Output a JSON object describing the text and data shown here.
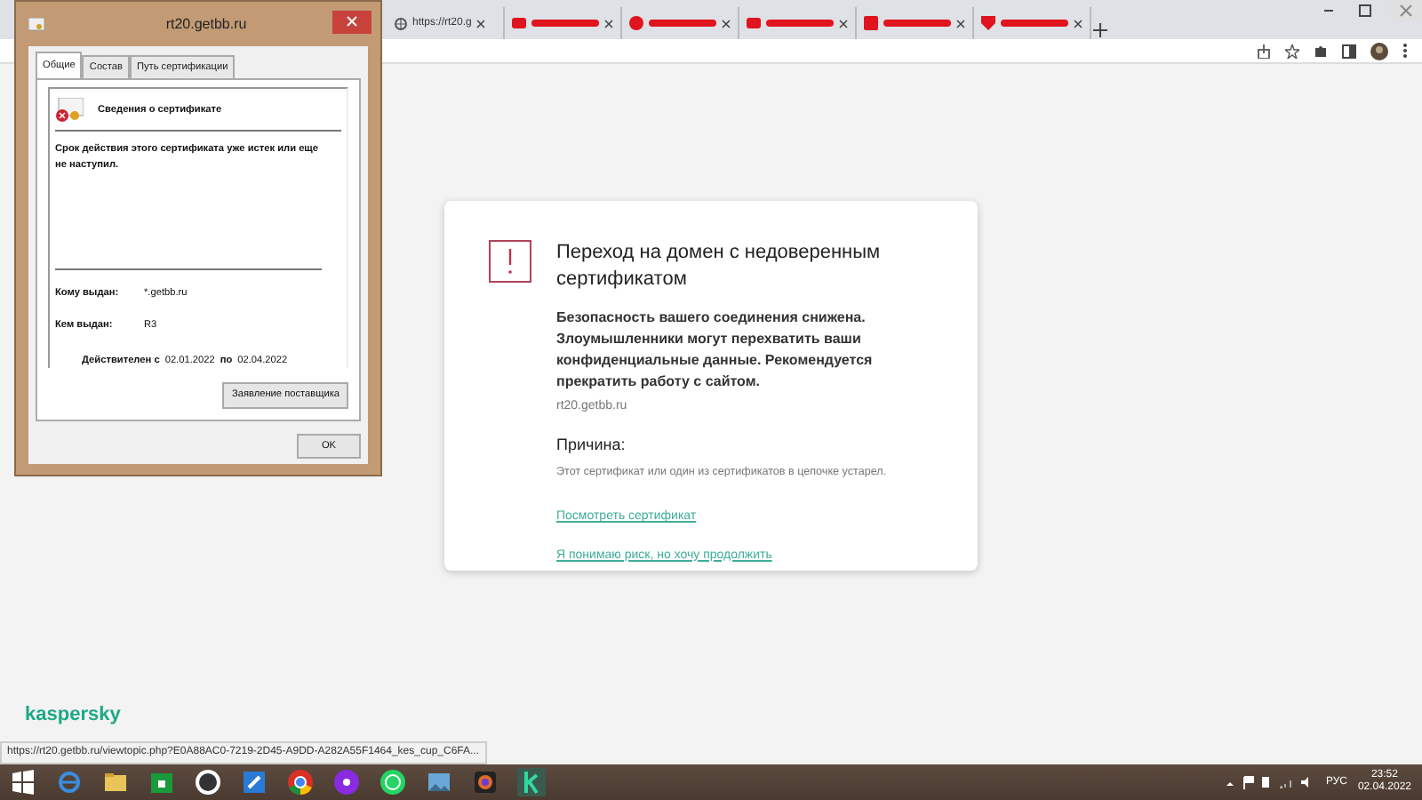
{
  "browser": {
    "tabs": [
      {
        "kind": "site",
        "label": "https://rt20.g",
        "selected": false
      },
      {
        "kind": "redacted",
        "selected": false
      },
      {
        "kind": "redacted",
        "selected": false
      },
      {
        "kind": "redacted",
        "selected": false
      },
      {
        "kind": "redacted",
        "selected": false
      },
      {
        "kind": "redacted",
        "selected": false
      }
    ]
  },
  "warning_card": {
    "title": "Переход на домен с недоверенным сертификатом",
    "message": "Безопасность вашего соединения снижена. Злоумышленники могут перехватить ваши конфиденциальные данные. Рекомендуется прекратить работу с сайтом.",
    "domain": "rt20.getbb.ru",
    "reason_heading": "Причина:",
    "reason": "Этот сертификат или один из сертификатов в цепочке устарел.",
    "links": [
      "Посмотреть сертификат",
      "Я понимаю риск, но хочу продолжить"
    ]
  },
  "brand": "kaspersky",
  "status_url": "https://rt20.getbb.ru/viewtopic.php?E0A88AC0-7219-2D45-A9DD-A282A55F1464_kes_cup_C6FA...",
  "certificate_dialog": {
    "title": "rt20.getbb.ru",
    "tabs": [
      {
        "label": "Общие",
        "selected": true
      },
      {
        "label": "Состав",
        "selected": false
      },
      {
        "label": "Путь сертификации",
        "selected": false
      }
    ],
    "heading": "Сведения о сертификате",
    "status": "Срок действия этого сертификата уже истек или еще не наступил.",
    "fields": [
      {
        "label": "Кому выдан:",
        "value": "*.getbb.ru"
      },
      {
        "label": "Кем выдан:",
        "value": "R3"
      }
    ],
    "validity": {
      "from_label": "Действителен с",
      "from": "02.01.2022",
      "to_label": "по",
      "to": "02.04.2022"
    },
    "issuer_button": "Заявление поставщика",
    "ok_button": "OK"
  },
  "taskbar": {
    "language": "РУС",
    "time": "23:52",
    "date": "02.04.2022"
  }
}
